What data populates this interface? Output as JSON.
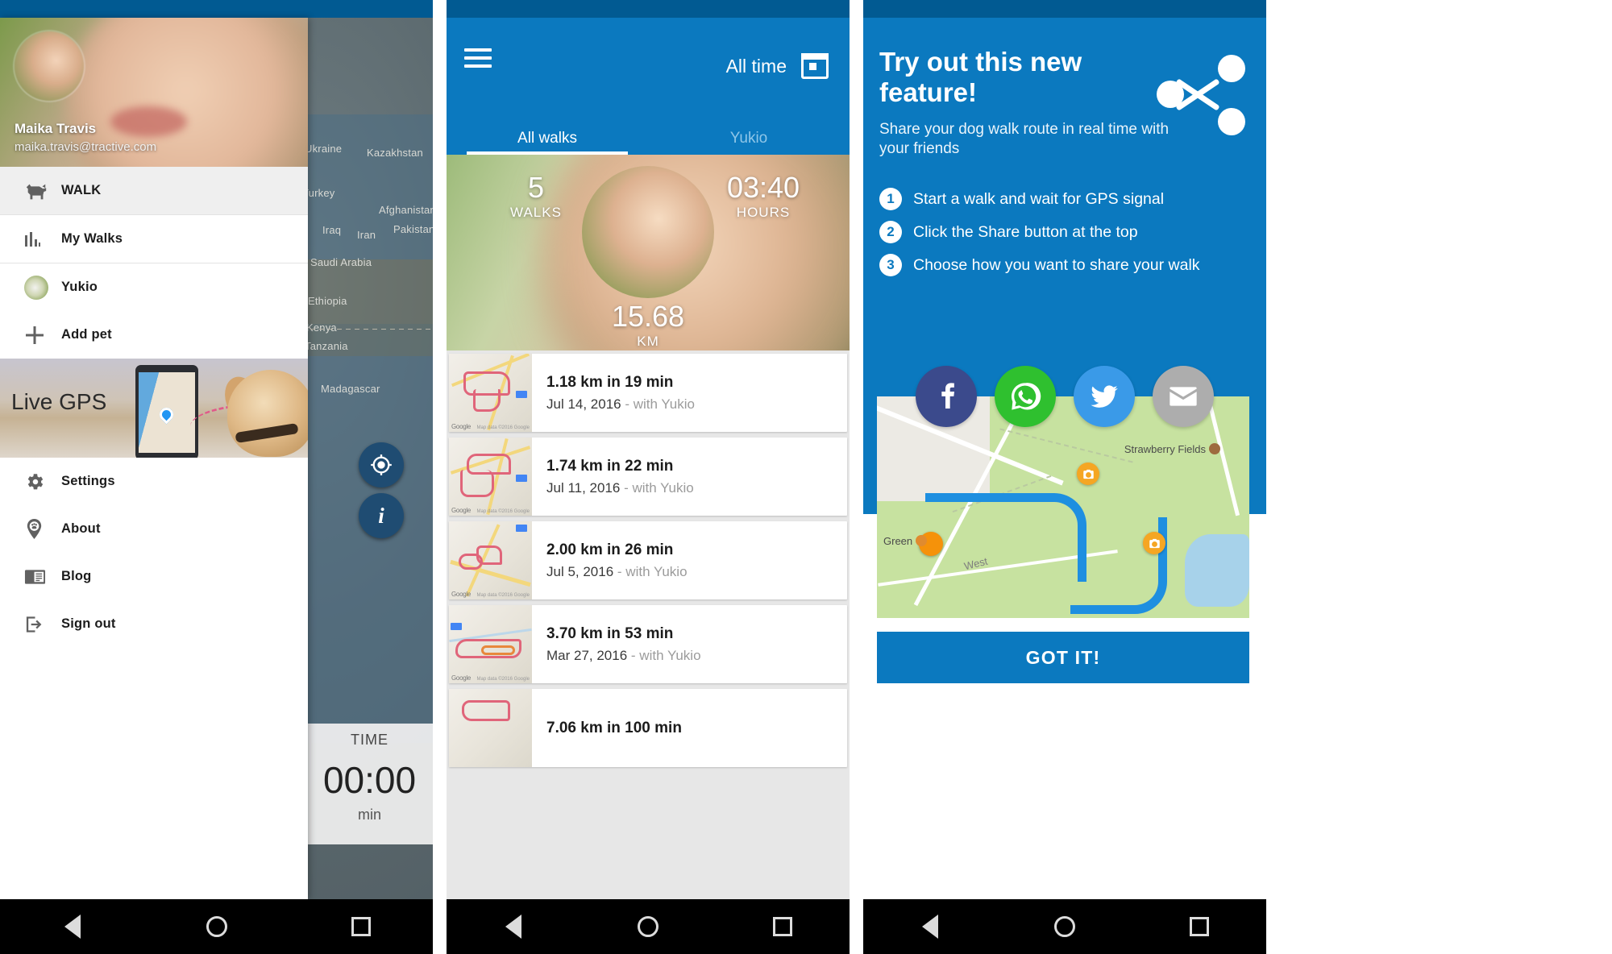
{
  "drawer": {
    "user": {
      "name": "Maika Travis",
      "email": "maika.travis@tractive.com"
    },
    "items": [
      {
        "label": "WALK",
        "icon": "dog-icon",
        "active": true
      },
      {
        "label": "My Walks",
        "icon": "bar-chart-icon",
        "active": false
      },
      {
        "label": "Yukio",
        "icon": "pet-avatar",
        "active": false
      },
      {
        "label": "Add pet",
        "icon": "plus-icon",
        "active": false
      }
    ],
    "promo": {
      "label": "Live GPS"
    },
    "bottom_items": [
      {
        "label": "Settings",
        "icon": "gear-icon"
      },
      {
        "label": "About",
        "icon": "paw-pin-icon"
      },
      {
        "label": "Blog",
        "icon": "article-icon"
      },
      {
        "label": "Sign out",
        "icon": "sign-out-icon"
      }
    ]
  },
  "map_screen": {
    "labels": [
      "Kazakhstan",
      "Turkey",
      "Iran",
      "Afghanistan",
      "Pakistan",
      "Iraq",
      "Saudi Arabia",
      "Ethiopia",
      "Kenya",
      "Tanzania",
      "Madagascar",
      "Ukraine"
    ],
    "timer": {
      "label": "TIME",
      "value": "00:00",
      "unit": "min"
    }
  },
  "walks_screen": {
    "appbar": {
      "menu_icon": "hamburger-icon",
      "period": "All time",
      "calendar_icon": "calendar-icon"
    },
    "tabs": [
      {
        "label": "All walks",
        "active": true
      },
      {
        "label": "Yukio",
        "active": false
      }
    ],
    "stats": {
      "walks": {
        "value": "5",
        "unit": "WALKS"
      },
      "hours": {
        "value": "03:40",
        "unit": "HOURS"
      },
      "distance": {
        "value": "15.68",
        "unit": "KM"
      }
    },
    "walks": [
      {
        "title": "1.18 km in 19 min",
        "date": "Jul 14, 2016",
        "with": " - with Yukio"
      },
      {
        "title": "1.74 km in 22 min",
        "date": "Jul 11, 2016",
        "with": " - with Yukio"
      },
      {
        "title": "2.00 km in 26 min",
        "date": "Jul 5, 2016",
        "with": " - with Yukio"
      },
      {
        "title": "3.70 km in 53 min",
        "date": "Mar 27, 2016",
        "with": " - with Yukio"
      },
      {
        "title": "7.06 km in 100 min",
        "date": "",
        "with": ""
      }
    ]
  },
  "share_screen": {
    "title": "Try out this new feature!",
    "subtitle": "Share your dog walk route in real time with your friends",
    "share_icon": "share-nodes-icon",
    "steps": [
      {
        "n": "1",
        "text": "Start a walk and wait for GPS signal"
      },
      {
        "n": "2",
        "text": "Click the Share button at the top"
      },
      {
        "n": "3",
        "text": "Choose how you want to share your walk"
      }
    ],
    "socials": [
      {
        "name": "facebook-icon",
        "color": "#3b4a8c"
      },
      {
        "name": "whatsapp-icon",
        "color": "#2fc02f"
      },
      {
        "name": "twitter-icon",
        "color": "#3a9ae8"
      },
      {
        "name": "email-icon",
        "color": "#adadad"
      }
    ],
    "map_labels": [
      {
        "text": "Strawberry Fields"
      },
      {
        "text": "Green"
      },
      {
        "text": "West"
      }
    ],
    "cta": "GOT IT!"
  },
  "system_nav": {
    "back": "back-triangle-icon",
    "home": "home-circle-icon",
    "recents": "recents-square-icon"
  },
  "colors": {
    "primary": "#0b79bf",
    "status_bar": "#015a92",
    "route": "#1e8fe0",
    "marker": "#f5a623"
  }
}
